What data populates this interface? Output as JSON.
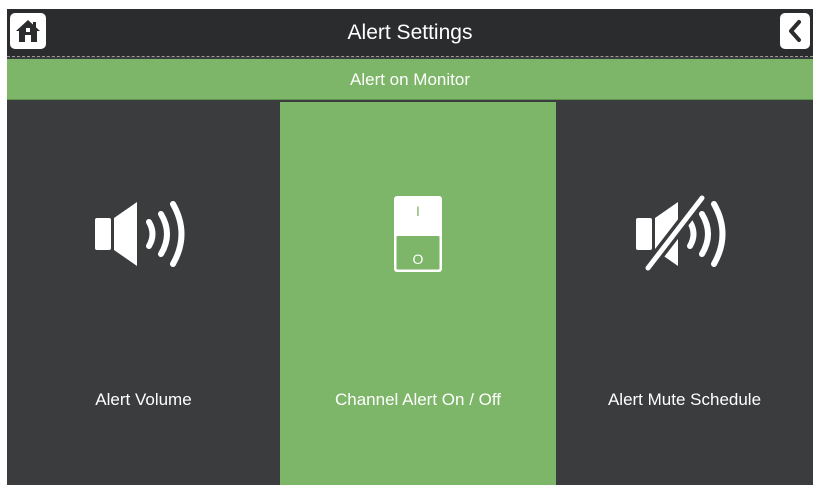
{
  "header": {
    "title": "Alert Settings"
  },
  "section": {
    "title": "Alert on Monitor"
  },
  "tiles": [
    {
      "label": "Alert Volume",
      "icon": "speaker-volume-icon",
      "selected": false
    },
    {
      "label": "Channel Alert On / Off",
      "icon": "toggle-switch-icon",
      "selected": true
    },
    {
      "label": "Alert Mute Schedule",
      "icon": "speaker-mute-icon",
      "selected": false
    }
  ],
  "switch_icon": {
    "on_mark": "I",
    "off_mark": "O"
  },
  "colors": {
    "accent_green": "#7db668",
    "tile_dark": "#3a3c3e",
    "header_dark": "#2b2c2e",
    "text": "#ffffff"
  }
}
